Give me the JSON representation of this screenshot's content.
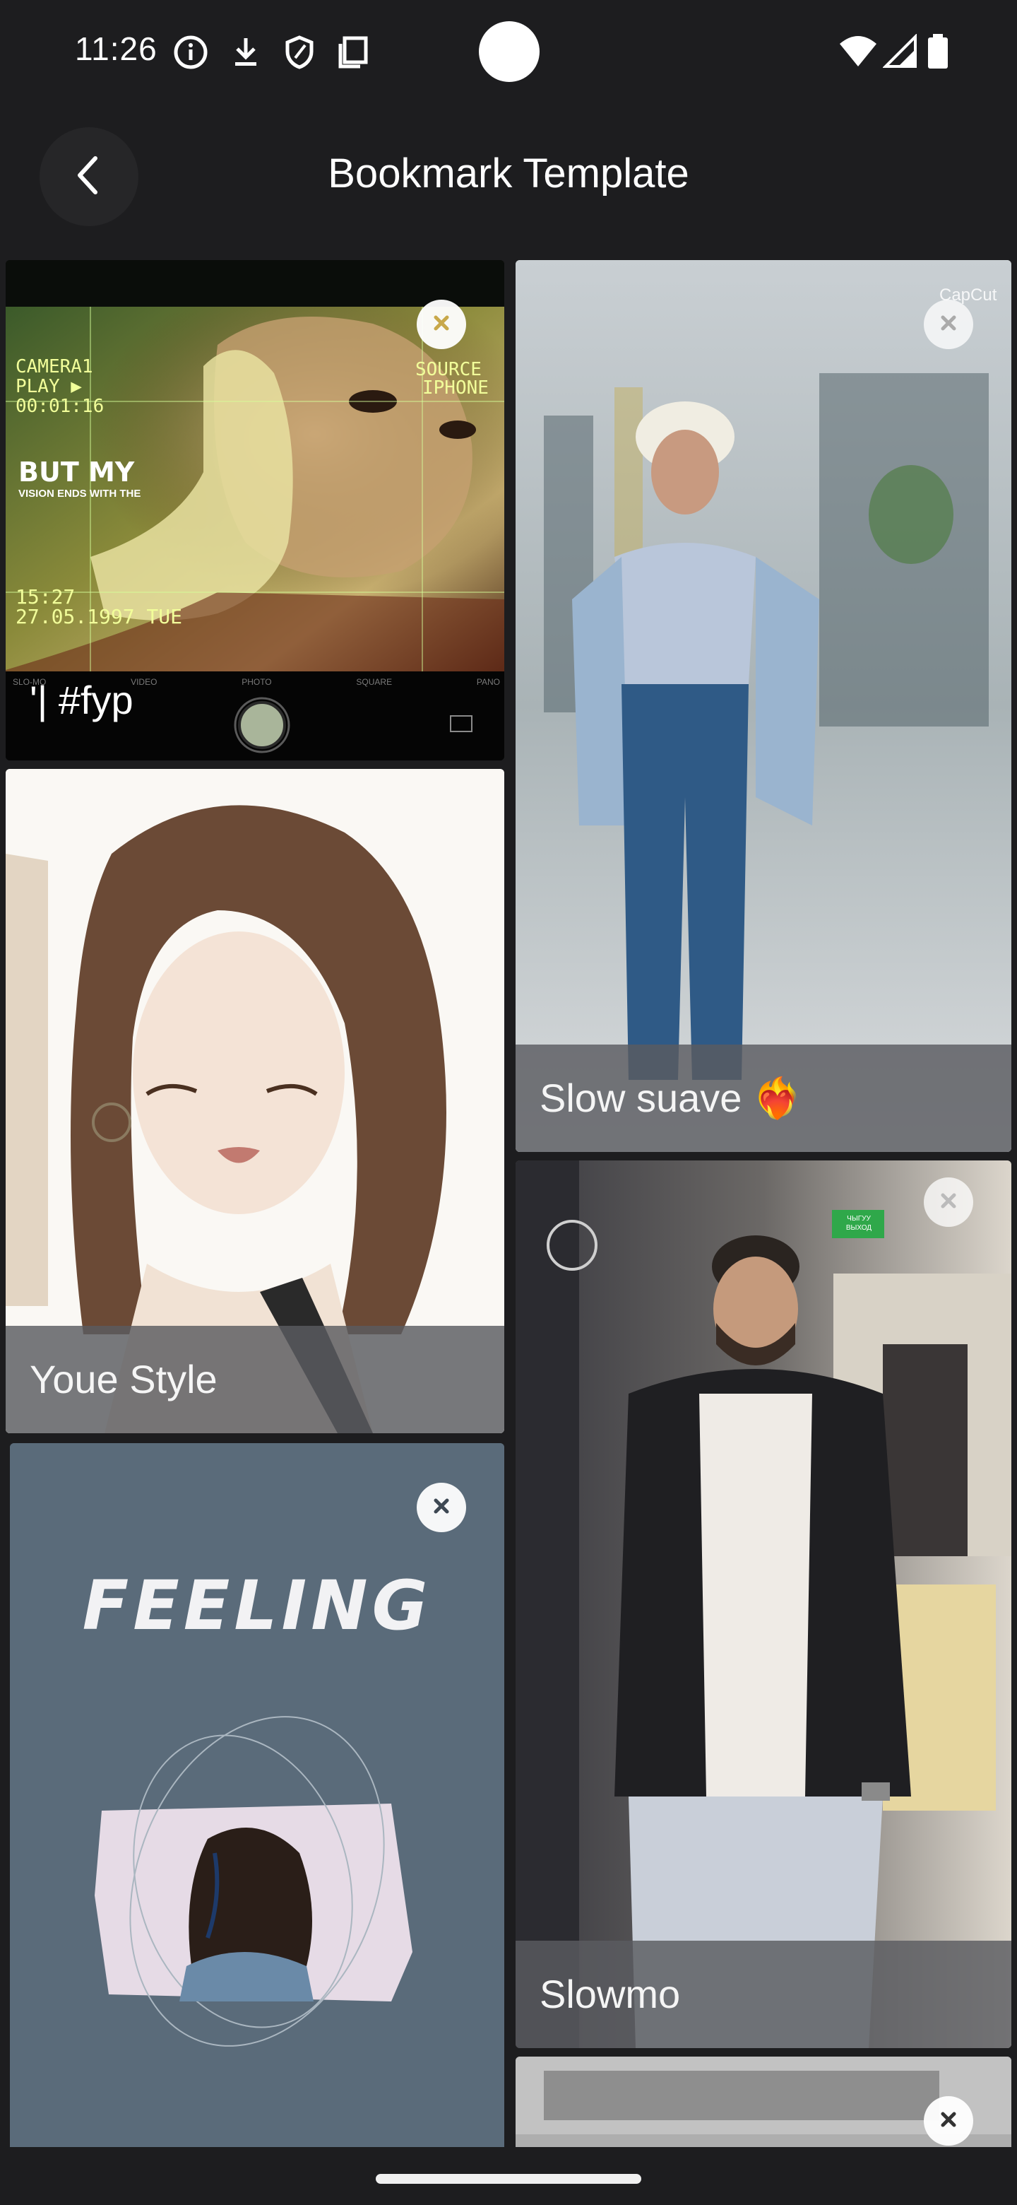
{
  "status_bar": {
    "time": "11:26",
    "icons": [
      "info-icon",
      "download-icon",
      "shield-icon",
      "copy-icon",
      "wifi-icon",
      "signal-icon",
      "battery-icon"
    ]
  },
  "app_bar": {
    "title": "Bookmark Template",
    "back_icon": "chevron-left-icon"
  },
  "templates": [
    {
      "caption": "'| #fyp",
      "overlay": {
        "camera": "CAMERA1",
        "play": "PLAY ▶",
        "timecode": "00:01:16",
        "source": "SOURCE",
        "device": "IPHONE",
        "headline": "BUT MY",
        "subline": "VISION ENDS WITH THE",
        "time": "15:27",
        "date": "27.05.1997 TUE",
        "modes": [
          "SLO-MO",
          "VIDEO",
          "PHOTO",
          "SQUARE",
          "PANO"
        ]
      }
    },
    {
      "caption": "Slow suave ❤️‍🔥",
      "watermark": "CapCut"
    },
    {
      "caption": "Youe Style"
    },
    {
      "caption": "Slowmo",
      "sign": "ЧЫГУУ ВЫХОД"
    },
    {
      "caption": "",
      "headline": "FEELING"
    },
    {
      "caption": ""
    }
  ],
  "colors": {
    "background": "#1d1d1f",
    "caption_bg": "#5a5c60",
    "feeling_bg": "#5a6b7a",
    "remove_button": "#ffffff"
  }
}
